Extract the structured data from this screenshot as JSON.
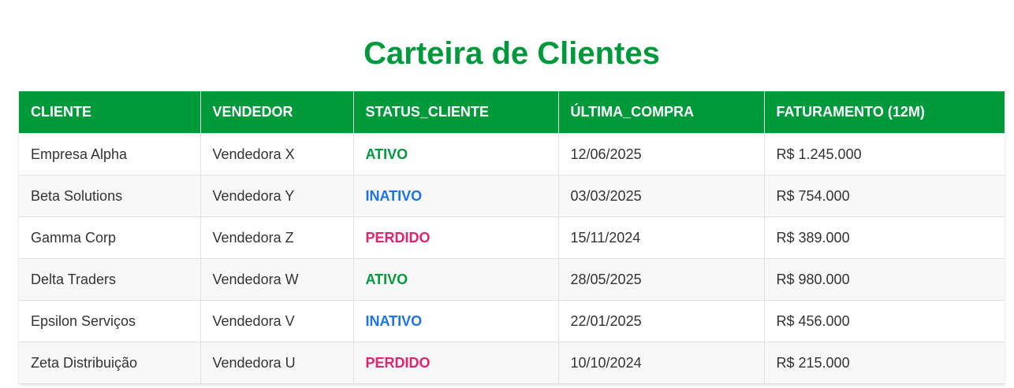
{
  "page_title": "Carteira de Clientes",
  "columns": [
    "CLIENTE",
    "VENDEDOR",
    "STATUS_CLIENTE",
    "ÚLTIMA_COMPRA",
    "FATURAMENTO (12M)"
  ],
  "rows": [
    {
      "cliente": "Empresa Alpha",
      "vendedor": "Vendedora X",
      "status": "ATIVO",
      "ultima_compra": "12/06/2025",
      "faturamento": "R$ 1.245.000"
    },
    {
      "cliente": "Beta Solutions",
      "vendedor": "Vendedora Y",
      "status": "INATIVO",
      "ultima_compra": "03/03/2025",
      "faturamento": "R$ 754.000"
    },
    {
      "cliente": "Gamma Corp",
      "vendedor": "Vendedora Z",
      "status": "PERDIDO",
      "ultima_compra": "15/11/2024",
      "faturamento": "R$ 389.000"
    },
    {
      "cliente": "Delta Traders",
      "vendedor": "Vendedora W",
      "status": "ATIVO",
      "ultima_compra": "28/05/2025",
      "faturamento": "R$ 980.000"
    },
    {
      "cliente": "Epsilon Serviços",
      "vendedor": "Vendedora V",
      "status": "INATIVO",
      "ultima_compra": "22/01/2025",
      "faturamento": "R$ 456.000"
    },
    {
      "cliente": "Zeta Distribuição",
      "vendedor": "Vendedora U",
      "status": "PERDIDO",
      "ultima_compra": "10/10/2024",
      "faturamento": "R$ 215.000"
    }
  ],
  "colors": {
    "accent": "#009a3a",
    "status_ativo": "#009a3a",
    "status_inativo": "#1a73e8",
    "status_perdido": "#e0246e"
  }
}
